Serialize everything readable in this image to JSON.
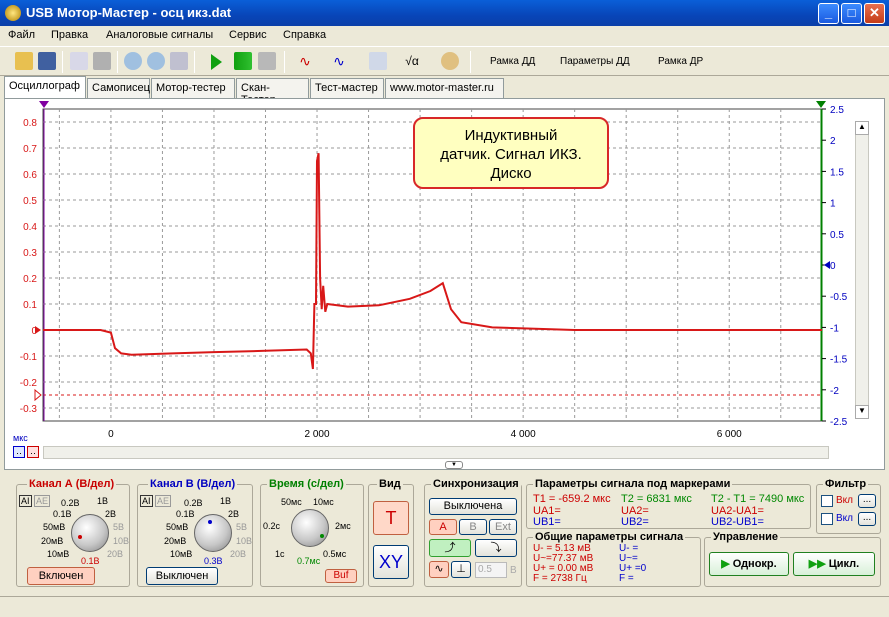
{
  "window": {
    "title": "USB Мотор-Мастер - осц икз.dat",
    "min": "_",
    "max": "□",
    "close": "✕"
  },
  "menu": [
    "Файл",
    "Правка",
    "Аналоговые сигналы",
    "Сервис",
    "Справка"
  ],
  "toolbar": {
    "frame_dd": "Рамка ДД",
    "params_dd": "Параметры ДД",
    "frame_dr": "Рамка ДР"
  },
  "tabs": [
    "Осциллограф",
    "Самописец",
    "Мотор-тестер",
    "Скан-Тестер",
    "Тест-мастер",
    "www.motor-master.ru"
  ],
  "scope": {
    "annotation": [
      "Индуктивный",
      "датчик. Сигнал ИКЗ.",
      "Диско"
    ],
    "time_unit": "мкс",
    "colors": {
      "trace": "#d81818",
      "grid": "#9a9a9a",
      "left_axis": "#d81818",
      "right_axis": "#0000c0"
    }
  },
  "chart_data": {
    "type": "line",
    "x_ticks": [
      {
        "v": 0,
        "t": "0"
      },
      {
        "v": 2000,
        "t": "2 000"
      },
      {
        "v": 4000,
        "t": "4 000"
      },
      {
        "v": 6000,
        "t": "6 000"
      }
    ],
    "xlim": [
      -659,
      6900
    ],
    "y_left_ticks": [
      "0.8",
      "0.7",
      "0.6",
      "0.5",
      "0.4",
      "0.3",
      "0.2",
      "0.1",
      "0",
      "-0.1",
      "-0.2",
      "-0.3"
    ],
    "ylim_left": [
      -0.35,
      0.85
    ],
    "y_right_ticks": [
      "2.5",
      "2",
      "1.5",
      "1",
      "0.5",
      "0",
      "-0.5",
      "-1",
      "-1.5",
      "-2",
      "-2.5"
    ],
    "ylim_right": [
      -2.5,
      2.5
    ],
    "grid": true,
    "series": [
      {
        "values": [
          [
            -659,
            0.0
          ],
          [
            -100,
            0.0
          ],
          [
            0,
            -0.01
          ],
          [
            40,
            -0.07
          ],
          [
            100,
            -0.09
          ],
          [
            200,
            -0.095
          ],
          [
            600,
            -0.09
          ],
          [
            1000,
            -0.085
          ],
          [
            1500,
            -0.08
          ],
          [
            1900,
            -0.075
          ],
          [
            1940,
            -0.09
          ],
          [
            1960,
            -0.15
          ],
          [
            1975,
            0.1
          ],
          [
            1990,
            0.1
          ],
          [
            2000,
            0.65
          ],
          [
            2015,
            0.68
          ],
          [
            2030,
            0.2
          ],
          [
            2045,
            0.08
          ],
          [
            2060,
            0.17
          ],
          [
            2080,
            0.07
          ],
          [
            2100,
            0.1
          ],
          [
            2300,
            0.09
          ],
          [
            2600,
            0.095
          ],
          [
            2900,
            0.12
          ],
          [
            3100,
            0.15
          ],
          [
            3220,
            0.18
          ],
          [
            3300,
            0.08
          ],
          [
            3400,
            0.03
          ],
          [
            3700,
            0.01
          ],
          [
            4500,
            0.0
          ],
          [
            6900,
            0.0
          ]
        ]
      }
    ]
  },
  "channel_a": {
    "title": "Канал А (В/дел)",
    "labels": [
      "0.2В",
      "1В",
      "0.1В",
      "2В",
      "50мВ",
      "5В",
      "20мВ",
      "10В",
      "10мВ",
      "20В"
    ],
    "value": "0.1В",
    "button": "Включен",
    "mode1": "AI",
    "mode2": "AE"
  },
  "channel_b": {
    "title": "Канал В (В/дел)",
    "labels": [
      "0.2В",
      "1В",
      "0.1В",
      "2В",
      "50мВ",
      "5В",
      "20мВ",
      "10В",
      "10мВ",
      "20В"
    ],
    "value": "0.3В",
    "button": "Выключен",
    "mode1": "AI",
    "mode2": "AE"
  },
  "time": {
    "title": "Время (с/дел)",
    "labels": [
      "50мс",
      "10мс",
      "0.2с",
      "2мс",
      "1с",
      "0.5мс"
    ],
    "value": "0.7мс",
    "button": "Buf"
  },
  "view": {
    "title": "Вид",
    "t": "T",
    "xy": "XY"
  },
  "sync": {
    "title": "Синхронизация",
    "state": "Выключена",
    "a": "A",
    "b": "B",
    "ext": "Ext",
    "level": "0.5",
    "unit": "В"
  },
  "markers": {
    "title": "Параметры сигнала под маркерами",
    "t1": "T1 = -659.2 мкс",
    "t2": "T2 = 6831 мкс",
    "dt": "T2 - T1 = 7490 мкс",
    "ua1": "UA1=",
    "ua2": "UA2=",
    "dua": "UA2-UA1=",
    "ub1": "UB1=",
    "ub2": "UB2=",
    "dub": "UB2-UB1="
  },
  "general": {
    "title": "Общие параметры сигнала",
    "u_minus": "U- = 5.13 мВ",
    "u_tilde": "U~=77.37 мВ",
    "u_plus": "U+ = 0.00 мВ",
    "f": "F = 2738 Гц",
    "u_minus_b": "U-  =",
    "u_tilde_b": "U~=",
    "u_plus_b": "U+  =0",
    "f_b": "F  ="
  },
  "filter": {
    "title": "Фильтр",
    "on1": "Вкл",
    "on2": "Вкл",
    "dots": "..."
  },
  "control": {
    "title": "Управление",
    "single": "Однокр.",
    "cycle": "Цикл."
  }
}
